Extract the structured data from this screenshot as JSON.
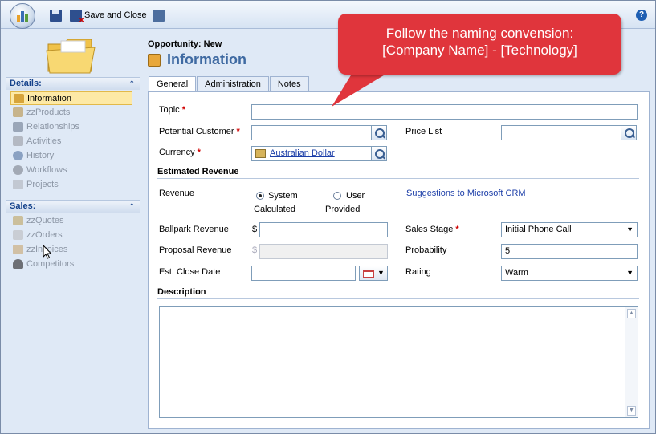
{
  "toolbar": {
    "save_close_label": "Save and Close",
    "help_label": "?"
  },
  "nav": {
    "details_header": "Details:",
    "details_items": [
      {
        "label": "Information",
        "icon": "info-icon"
      },
      {
        "label": "zzProducts",
        "icon": "box-icon"
      },
      {
        "label": "Relationships",
        "icon": "people-icon"
      },
      {
        "label": "Activities",
        "icon": "activity-icon"
      },
      {
        "label": "History",
        "icon": "clock-icon"
      },
      {
        "label": "Workflows",
        "icon": "gear-icon"
      },
      {
        "label": "Projects",
        "icon": "document-icon"
      }
    ],
    "sales_header": "Sales:",
    "sales_items": [
      {
        "label": "zzQuotes",
        "icon": "quote-icon"
      },
      {
        "label": "zzOrders",
        "icon": "order-icon"
      },
      {
        "label": "zzInvoices",
        "icon": "invoice-icon"
      },
      {
        "label": "Competitors",
        "icon": "competitor-icon"
      }
    ]
  },
  "header": {
    "entity": "Opportunity: New",
    "title": "Information"
  },
  "tabs": [
    "General",
    "Administration",
    "Notes"
  ],
  "form": {
    "topic_label": "Topic",
    "topic_value": "",
    "potential_customer_label": "Potential Customer",
    "price_list_label": "Price List",
    "currency_label": "Currency",
    "currency_value": "Australian Dollar",
    "estimated_revenue_section": "Estimated Revenue",
    "revenue_label": "Revenue",
    "revenue_option_system": "System",
    "revenue_option_system_sub": "Calculated",
    "revenue_option_user": "User",
    "revenue_option_user_sub": "Provided",
    "suggestions_link": "Suggestions to Microsoft CRM",
    "ballpark_label": "Ballpark Revenue",
    "proposal_label": "Proposal Revenue",
    "currency_symbol": "$",
    "close_date_label": "Est. Close Date",
    "sales_stage_label": "Sales Stage",
    "sales_stage_value": "Initial Phone Call",
    "probability_label": "Probability",
    "probability_value": "5",
    "rating_label": "Rating",
    "rating_value": "Warm",
    "description_section": "Description"
  },
  "callout": {
    "line1": "Follow the naming convension:",
    "line2": "[Company Name] - [Technology]"
  },
  "colors": {
    "callout": "#e0353c",
    "title": "#3f6aa2",
    "link": "#1c3ea8",
    "required": "#d00000"
  }
}
